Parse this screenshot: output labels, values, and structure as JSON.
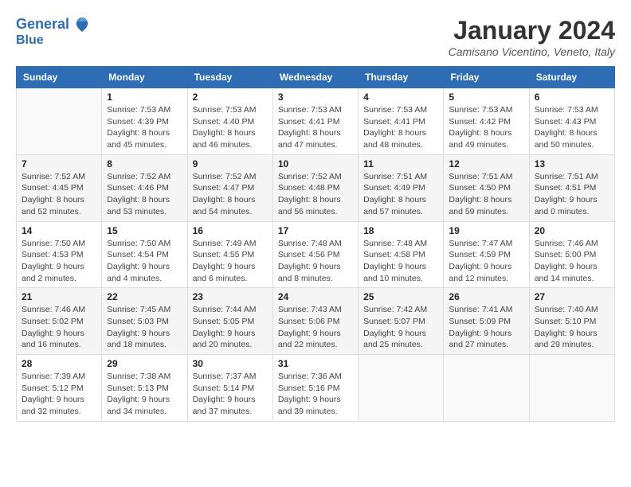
{
  "header": {
    "logo_line1": "General",
    "logo_line2": "Blue",
    "month_year": "January 2024",
    "location": "Camisano Vicentino, Veneto, Italy"
  },
  "weekdays": [
    "Sunday",
    "Monday",
    "Tuesday",
    "Wednesday",
    "Thursday",
    "Friday",
    "Saturday"
  ],
  "weeks": [
    [
      {
        "day": "",
        "sunrise": "",
        "sunset": "",
        "daylight": ""
      },
      {
        "day": "1",
        "sunrise": "Sunrise: 7:53 AM",
        "sunset": "Sunset: 4:39 PM",
        "daylight": "Daylight: 8 hours and 45 minutes."
      },
      {
        "day": "2",
        "sunrise": "Sunrise: 7:53 AM",
        "sunset": "Sunset: 4:40 PM",
        "daylight": "Daylight: 8 hours and 46 minutes."
      },
      {
        "day": "3",
        "sunrise": "Sunrise: 7:53 AM",
        "sunset": "Sunset: 4:41 PM",
        "daylight": "Daylight: 8 hours and 47 minutes."
      },
      {
        "day": "4",
        "sunrise": "Sunrise: 7:53 AM",
        "sunset": "Sunset: 4:41 PM",
        "daylight": "Daylight: 8 hours and 48 minutes."
      },
      {
        "day": "5",
        "sunrise": "Sunrise: 7:53 AM",
        "sunset": "Sunset: 4:42 PM",
        "daylight": "Daylight: 8 hours and 49 minutes."
      },
      {
        "day": "6",
        "sunrise": "Sunrise: 7:53 AM",
        "sunset": "Sunset: 4:43 PM",
        "daylight": "Daylight: 8 hours and 50 minutes."
      }
    ],
    [
      {
        "day": "7",
        "sunrise": "Sunrise: 7:52 AM",
        "sunset": "Sunset: 4:45 PM",
        "daylight": "Daylight: 8 hours and 52 minutes."
      },
      {
        "day": "8",
        "sunrise": "Sunrise: 7:52 AM",
        "sunset": "Sunset: 4:46 PM",
        "daylight": "Daylight: 8 hours and 53 minutes."
      },
      {
        "day": "9",
        "sunrise": "Sunrise: 7:52 AM",
        "sunset": "Sunset: 4:47 PM",
        "daylight": "Daylight: 8 hours and 54 minutes."
      },
      {
        "day": "10",
        "sunrise": "Sunrise: 7:52 AM",
        "sunset": "Sunset: 4:48 PM",
        "daylight": "Daylight: 8 hours and 56 minutes."
      },
      {
        "day": "11",
        "sunrise": "Sunrise: 7:51 AM",
        "sunset": "Sunset: 4:49 PM",
        "daylight": "Daylight: 8 hours and 57 minutes."
      },
      {
        "day": "12",
        "sunrise": "Sunrise: 7:51 AM",
        "sunset": "Sunset: 4:50 PM",
        "daylight": "Daylight: 8 hours and 59 minutes."
      },
      {
        "day": "13",
        "sunrise": "Sunrise: 7:51 AM",
        "sunset": "Sunset: 4:51 PM",
        "daylight": "Daylight: 9 hours and 0 minutes."
      }
    ],
    [
      {
        "day": "14",
        "sunrise": "Sunrise: 7:50 AM",
        "sunset": "Sunset: 4:53 PM",
        "daylight": "Daylight: 9 hours and 2 minutes."
      },
      {
        "day": "15",
        "sunrise": "Sunrise: 7:50 AM",
        "sunset": "Sunset: 4:54 PM",
        "daylight": "Daylight: 9 hours and 4 minutes."
      },
      {
        "day": "16",
        "sunrise": "Sunrise: 7:49 AM",
        "sunset": "Sunset: 4:55 PM",
        "daylight": "Daylight: 9 hours and 6 minutes."
      },
      {
        "day": "17",
        "sunrise": "Sunrise: 7:48 AM",
        "sunset": "Sunset: 4:56 PM",
        "daylight": "Daylight: 9 hours and 8 minutes."
      },
      {
        "day": "18",
        "sunrise": "Sunrise: 7:48 AM",
        "sunset": "Sunset: 4:58 PM",
        "daylight": "Daylight: 9 hours and 10 minutes."
      },
      {
        "day": "19",
        "sunrise": "Sunrise: 7:47 AM",
        "sunset": "Sunset: 4:59 PM",
        "daylight": "Daylight: 9 hours and 12 minutes."
      },
      {
        "day": "20",
        "sunrise": "Sunrise: 7:46 AM",
        "sunset": "Sunset: 5:00 PM",
        "daylight": "Daylight: 9 hours and 14 minutes."
      }
    ],
    [
      {
        "day": "21",
        "sunrise": "Sunrise: 7:46 AM",
        "sunset": "Sunset: 5:02 PM",
        "daylight": "Daylight: 9 hours and 16 minutes."
      },
      {
        "day": "22",
        "sunrise": "Sunrise: 7:45 AM",
        "sunset": "Sunset: 5:03 PM",
        "daylight": "Daylight: 9 hours and 18 minutes."
      },
      {
        "day": "23",
        "sunrise": "Sunrise: 7:44 AM",
        "sunset": "Sunset: 5:05 PM",
        "daylight": "Daylight: 9 hours and 20 minutes."
      },
      {
        "day": "24",
        "sunrise": "Sunrise: 7:43 AM",
        "sunset": "Sunset: 5:06 PM",
        "daylight": "Daylight: 9 hours and 22 minutes."
      },
      {
        "day": "25",
        "sunrise": "Sunrise: 7:42 AM",
        "sunset": "Sunset: 5:07 PM",
        "daylight": "Daylight: 9 hours and 25 minutes."
      },
      {
        "day": "26",
        "sunrise": "Sunrise: 7:41 AM",
        "sunset": "Sunset: 5:09 PM",
        "daylight": "Daylight: 9 hours and 27 minutes."
      },
      {
        "day": "27",
        "sunrise": "Sunrise: 7:40 AM",
        "sunset": "Sunset: 5:10 PM",
        "daylight": "Daylight: 9 hours and 29 minutes."
      }
    ],
    [
      {
        "day": "28",
        "sunrise": "Sunrise: 7:39 AM",
        "sunset": "Sunset: 5:12 PM",
        "daylight": "Daylight: 9 hours and 32 minutes."
      },
      {
        "day": "29",
        "sunrise": "Sunrise: 7:38 AM",
        "sunset": "Sunset: 5:13 PM",
        "daylight": "Daylight: 9 hours and 34 minutes."
      },
      {
        "day": "30",
        "sunrise": "Sunrise: 7:37 AM",
        "sunset": "Sunset: 5:14 PM",
        "daylight": "Daylight: 9 hours and 37 minutes."
      },
      {
        "day": "31",
        "sunrise": "Sunrise: 7:36 AM",
        "sunset": "Sunset: 5:16 PM",
        "daylight": "Daylight: 9 hours and 39 minutes."
      },
      {
        "day": "",
        "sunrise": "",
        "sunset": "",
        "daylight": ""
      },
      {
        "day": "",
        "sunrise": "",
        "sunset": "",
        "daylight": ""
      },
      {
        "day": "",
        "sunrise": "",
        "sunset": "",
        "daylight": ""
      }
    ]
  ]
}
